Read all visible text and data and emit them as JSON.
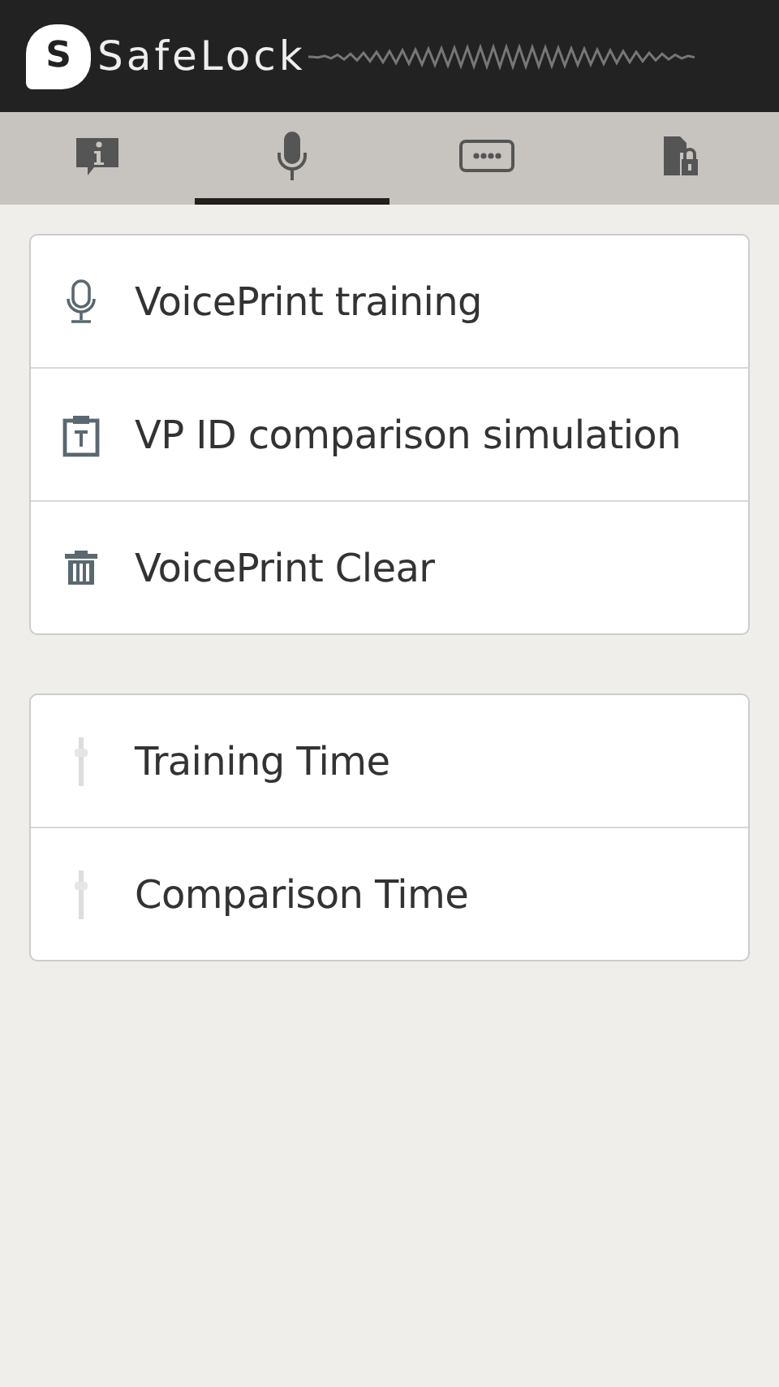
{
  "header": {
    "logo_mark": "S",
    "title": "SafeLock"
  },
  "tabs": [
    {
      "kind": "info",
      "selected": false
    },
    {
      "kind": "mic",
      "selected": true
    },
    {
      "kind": "password",
      "selected": false
    },
    {
      "kind": "lock",
      "selected": false
    }
  ],
  "groups": [
    {
      "items": [
        {
          "kind": "mic",
          "label": "VoicePrint training"
        },
        {
          "kind": "clipboard",
          "label": "VP ID comparison simulation"
        },
        {
          "kind": "trash",
          "label": "VoicePrint Clear"
        }
      ]
    },
    {
      "items": [
        {
          "kind": "gauge",
          "label": "Training Time"
        },
        {
          "kind": "gauge",
          "label": "Comparison Time"
        }
      ]
    }
  ]
}
